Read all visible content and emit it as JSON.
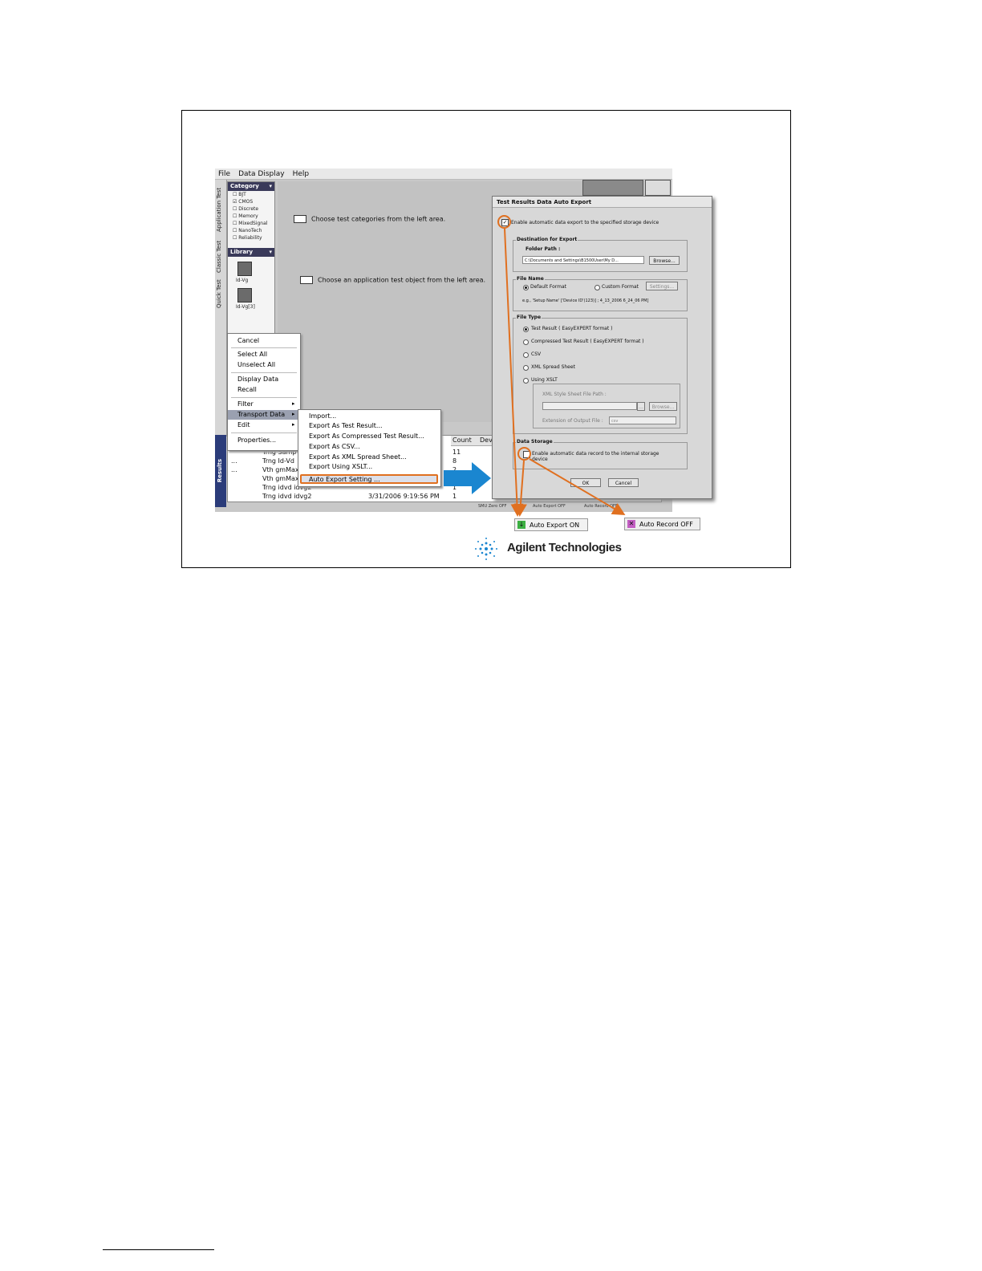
{
  "menubar": {
    "items": [
      "File",
      "Data Display",
      "Help"
    ]
  },
  "vertical_tabs": [
    "Application Test",
    "Classic Test",
    "Quick Test"
  ],
  "category_panel": {
    "header": "Category",
    "items": [
      "BJT",
      "CMOS",
      "Discrete",
      "Memory",
      "MixedSignal",
      "NanoTech",
      "Reliability"
    ],
    "checked": "CMOS"
  },
  "library_panel": {
    "header": "Library",
    "items": [
      "Id-Vg",
      "Id-Vg[3]"
    ]
  },
  "hints": {
    "categories": "Choose test categories from the left area.",
    "application": "Choose an application test object from the left area."
  },
  "results_tab": "Results",
  "table": {
    "columns": [
      "Count",
      "Dev"
    ],
    "rows": [
      {
        "name": "Trng Samp",
        "time": "",
        "count": "11"
      },
      {
        "name": "Trng Id-Vd",
        "time": "",
        "count": "8"
      },
      {
        "name": "Vth gmMax",
        "time": "",
        "count": "2"
      },
      {
        "name": "Vth gmMax",
        "time": "",
        "count": ""
      },
      {
        "name": "Trng idvd idvg2",
        "time": "",
        "count": "1"
      },
      {
        "name": "Trng idvd idvg2",
        "time": "3/31/2006 9:19:56 PM",
        "count": "1"
      }
    ]
  },
  "context_menu": {
    "items": [
      "Cancel",
      "Select All",
      "Unselect All",
      "Display Data",
      "Recall",
      "Filter",
      "Transport Data",
      "Edit",
      "Properties..."
    ]
  },
  "submenu": {
    "items": [
      "Import...",
      "Export As Test Result...",
      "Export As Compressed Test Result...",
      "Export As CSV...",
      "Export As XML Spread Sheet...",
      "Export Using XSLT...",
      "Auto Export Setting ..."
    ]
  },
  "dialog": {
    "title": "Test Results Data Auto Export",
    "enable_export": "Enable automatic data export to the specified storage device",
    "destination": {
      "label": "Destination for Export",
      "folder_label": "Folder Path :",
      "folder_value": "C:\\Documents and Settings\\B1500User\\My D...",
      "browse": "Browse..."
    },
    "file_name": {
      "label": "File Name",
      "default": "Default Format",
      "custom": "Custom Format",
      "settings": "Settings...",
      "example": "e.g., 'Setup Name' ['Device ID'(123)] ; 4_13_2006 6_24_06 PM]"
    },
    "file_type": {
      "label": "File Type",
      "options": [
        "Test Result ( EasyEXPERT format )",
        "Compressed Test Result ( EasyEXPERT format )",
        "CSV",
        "XML Spread Sheet",
        "Using XSLT"
      ],
      "xslt_path_label": "XML Style Sheet File Path :",
      "browse": "Browse...",
      "ext_label": "Extension of Output File :",
      "ext_value": "csv"
    },
    "data_storage": {
      "label": "Data Storage",
      "enable_record": "Enable automatic data record to the internal storage device"
    },
    "ok": "OK",
    "cancel": "Cancel"
  },
  "statusbar": {
    "items": [
      "SMU Zero OFF",
      "Auto Export OFF",
      "Auto Record OFF"
    ]
  },
  "badges": {
    "export_on": "Auto Export ON",
    "record_off": "Auto Record OFF"
  },
  "logo": {
    "text": "Agilent Technologies"
  },
  "colors": {
    "highlight": "#e07020",
    "arrow": "#1a86d0",
    "dialog_bg": "#d8d8d8"
  }
}
